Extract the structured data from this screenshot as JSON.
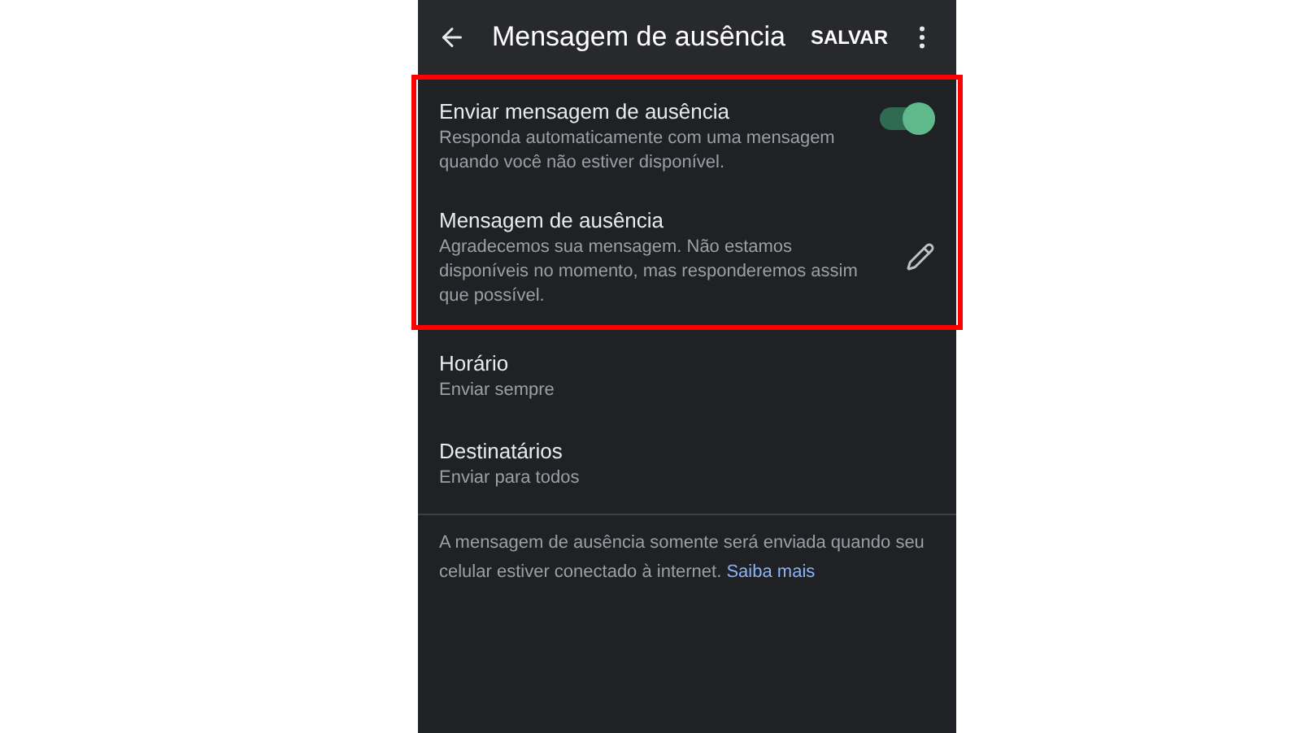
{
  "app_bar": {
    "title": "Mensagem de ausência",
    "action": "SALVAR"
  },
  "highlighted_settings": [
    {
      "kind": "toggle",
      "title": "Enviar mensagem de ausência",
      "subtitle": "Responda automaticamente com uma mensagem quando você não estiver disponível.",
      "on": true
    },
    {
      "kind": "edit",
      "title": "Mensagem de ausência",
      "subtitle": "Agradecemos sua mensagem. Não estamos disponíveis no momento, mas responderemos assim que possível."
    }
  ],
  "settings": [
    {
      "title": "Horário",
      "subtitle": "Enviar sempre"
    },
    {
      "title": "Destinatários",
      "subtitle": "Enviar para todos"
    }
  ],
  "footer": {
    "text": "A mensagem de ausência somente será enviada quando seu celular estiver conectado à internet.",
    "link": "Saiba mais"
  }
}
